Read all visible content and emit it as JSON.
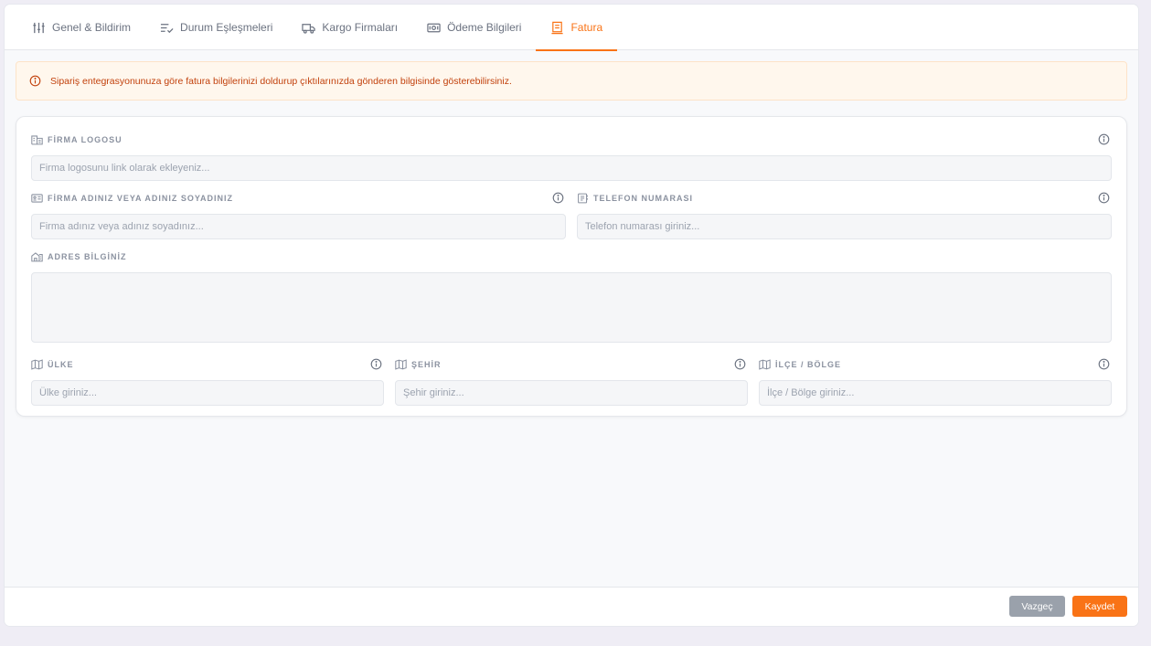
{
  "tabs": [
    {
      "label": "Genel & Bildirim",
      "icon": "sliders-icon"
    },
    {
      "label": "Durum Eşleşmeleri",
      "icon": "list-check-icon"
    },
    {
      "label": "Kargo Firmaları",
      "icon": "truck-icon"
    },
    {
      "label": "Ödeme Bilgileri",
      "icon": "money-icon"
    },
    {
      "label": "Fatura",
      "icon": "invoice-icon",
      "active": true
    }
  ],
  "alert": {
    "text": "Sipariş entegrasyonunuza göre fatura bilgilerinizi doldurup çıktılarınızda gönderen bilgisinde gösterebilirsiniz.",
    "icon": "info-icon"
  },
  "form": {
    "logo": {
      "label": "FİRMA LOGOSU",
      "placeholder": "Firma logosunu link olarak ekleyeniz..."
    },
    "company": {
      "label": "FİRMA ADINIZ VEYA ADINIZ SOYADINIZ",
      "placeholder": "Firma adınız veya adınız soyadınız..."
    },
    "phone": {
      "label": "TELEFON NUMARASI",
      "placeholder": "Telefon numarası giriniz..."
    },
    "address": {
      "label": "ADRES BİLGİNİZ",
      "placeholder": ""
    },
    "country": {
      "label": "ÜLKE",
      "placeholder": "Ülke giriniz..."
    },
    "city": {
      "label": "ŞEHİR",
      "placeholder": "Şehir giriniz..."
    },
    "district": {
      "label": "İLÇE / BÖLGE",
      "placeholder": "İlçe / Bölge giriniz..."
    }
  },
  "footer": {
    "cancel_label": "Vazgeç",
    "save_label": "Kaydet"
  },
  "colors": {
    "accent": "#f97316",
    "alert_bg": "#fff7ed",
    "alert_text": "#c2410c",
    "cancel_button": "#9aa1ab",
    "page_bg": "#efedf5"
  }
}
